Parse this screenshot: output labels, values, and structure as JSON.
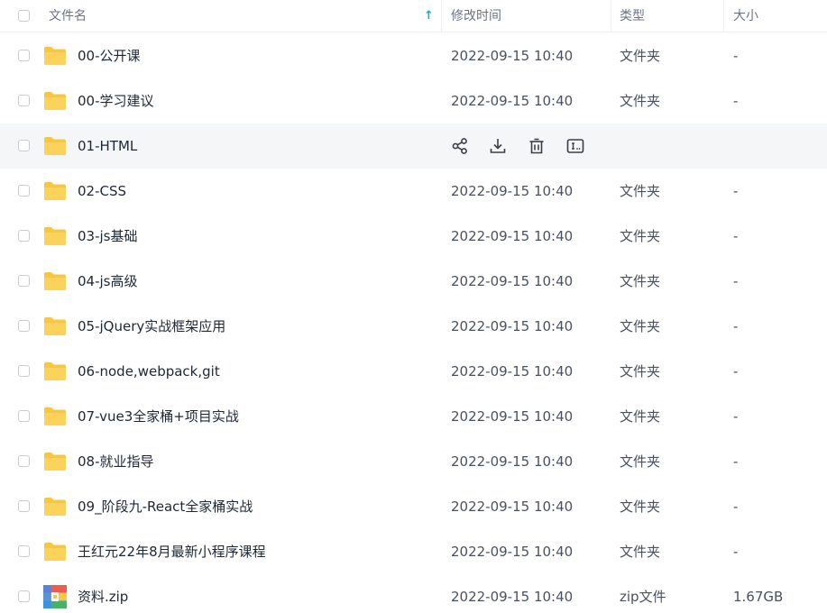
{
  "header": {
    "name": "文件名",
    "sort_icon": "arrow-up-icon",
    "time": "修改时间",
    "type": "类型",
    "size": "大小"
  },
  "colors": {
    "folder": "#f8c640",
    "accent": "#06a7ff",
    "hover_row": "#f5f6f8"
  },
  "row_actions": [
    "share-icon",
    "download-icon",
    "delete-icon",
    "rename-icon"
  ],
  "files": [
    {
      "name": "00-公开课",
      "time": "2022-09-15 10:40",
      "type": "文件夹",
      "size": "-",
      "icon": "folder-icon"
    },
    {
      "name": "00-学习建议",
      "time": "2022-09-15 10:40",
      "type": "文件夹",
      "size": "-",
      "icon": "folder-icon"
    },
    {
      "name": "01-HTML",
      "time": "",
      "type": "",
      "size": "",
      "icon": "folder-icon",
      "hovered": true
    },
    {
      "name": "02-CSS",
      "time": "2022-09-15 10:40",
      "type": "文件夹",
      "size": "-",
      "icon": "folder-icon"
    },
    {
      "name": "03-js基础",
      "time": "2022-09-15 10:40",
      "type": "文件夹",
      "size": "-",
      "icon": "folder-icon"
    },
    {
      "name": "04-js高级",
      "time": "2022-09-15 10:40",
      "type": "文件夹",
      "size": "-",
      "icon": "folder-icon"
    },
    {
      "name": "05-jQuery实战框架应用",
      "time": "2022-09-15 10:40",
      "type": "文件夹",
      "size": "-",
      "icon": "folder-icon"
    },
    {
      "name": "06-node,webpack,git",
      "time": "2022-09-15 10:40",
      "type": "文件夹",
      "size": "-",
      "icon": "folder-icon"
    },
    {
      "name": "07-vue3全家桶+项目实战",
      "time": "2022-09-15 10:40",
      "type": "文件夹",
      "size": "-",
      "icon": "folder-icon"
    },
    {
      "name": "08-就业指导",
      "time": "2022-09-15 10:40",
      "type": "文件夹",
      "size": "-",
      "icon": "folder-icon"
    },
    {
      "name": "09_阶段九-React全家桶实战",
      "time": "2022-09-15 10:40",
      "type": "文件夹",
      "size": "-",
      "icon": "folder-icon"
    },
    {
      "name": "王红元22年8月最新小程序课程",
      "time": "2022-09-15 10:40",
      "type": "文件夹",
      "size": "-",
      "icon": "folder-icon"
    },
    {
      "name": "资料.zip",
      "time": "2022-09-15 10:40",
      "type": "zip文件",
      "size": "1.67GB",
      "icon": "zip-file-icon"
    }
  ]
}
